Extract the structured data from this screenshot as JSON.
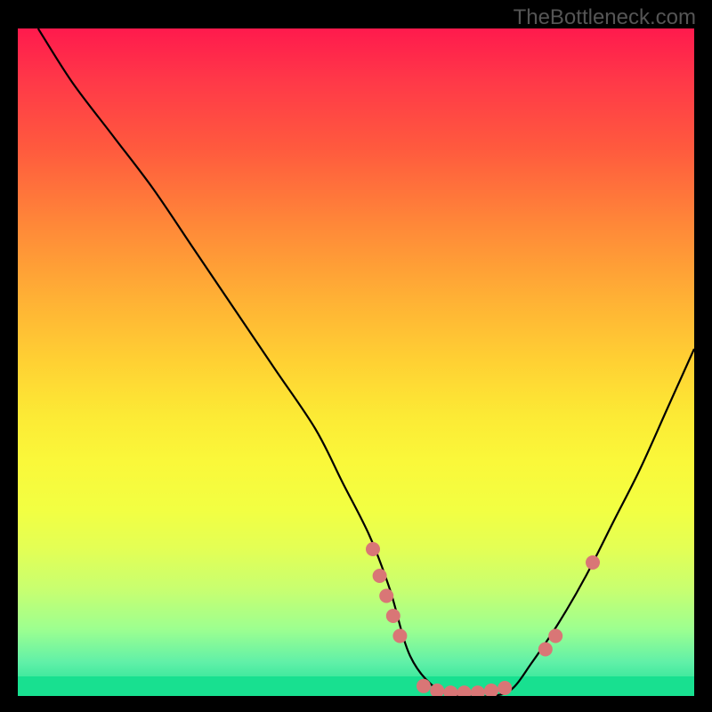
{
  "watermark": "TheBottleneck.com",
  "chart_data": {
    "type": "line",
    "title": "",
    "xlabel": "",
    "ylabel": "",
    "xlim": [
      0,
      100
    ],
    "ylim": [
      0,
      100
    ],
    "note": "Bottleneck curve. Y is bottleneck percentage (0=no bottleneck, green at bottom; ~100 at top, red). X is relative component performance. Curve falls from top-left, reaches a flat minimum near zero around x≈58–73, then rises to the right. Pink dots mark sampled hardware points along the curve.",
    "series": [
      {
        "name": "bottleneck_curve",
        "x": [
          3,
          8,
          14,
          20,
          26,
          32,
          38,
          44,
          48,
          52,
          55,
          58,
          62,
          66,
          70,
          73,
          76,
          80,
          84,
          88,
          92,
          96,
          100
        ],
        "y": [
          100,
          92,
          84,
          76,
          67,
          58,
          49,
          40,
          32,
          24,
          16,
          6,
          1,
          0,
          0,
          1,
          5,
          11,
          18,
          26,
          34,
          43,
          52
        ]
      }
    ],
    "points": [
      {
        "x": 52.5,
        "y": 22
      },
      {
        "x": 53.5,
        "y": 18
      },
      {
        "x": 54.5,
        "y": 15
      },
      {
        "x": 55.5,
        "y": 12
      },
      {
        "x": 56.5,
        "y": 9
      },
      {
        "x": 60,
        "y": 1.5
      },
      {
        "x": 62,
        "y": 0.8
      },
      {
        "x": 64,
        "y": 0.5
      },
      {
        "x": 66,
        "y": 0.5
      },
      {
        "x": 68,
        "y": 0.5
      },
      {
        "x": 70,
        "y": 0.8
      },
      {
        "x": 72,
        "y": 1.2
      },
      {
        "x": 78,
        "y": 7
      },
      {
        "x": 79.5,
        "y": 9
      },
      {
        "x": 85,
        "y": 20
      }
    ],
    "point_color": "#d97676",
    "curve_color": "#000000"
  }
}
